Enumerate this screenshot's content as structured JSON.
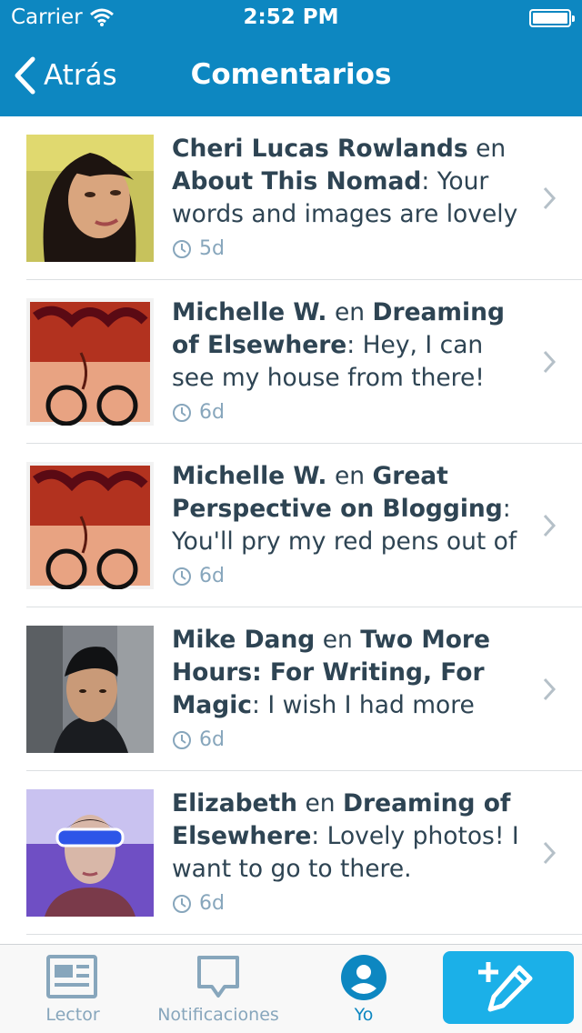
{
  "status_bar": {
    "carrier": "Carrier",
    "time": "2:52 PM"
  },
  "nav": {
    "back_label": "Atrás",
    "title": "Comentarios"
  },
  "comments": [
    {
      "author": "Cheri Lucas Rowlands",
      "connector": "en",
      "post": "About This Nomad",
      "excerpt": "Your words and images are lovely",
      "time": "5d"
    },
    {
      "author": "Michelle W.",
      "connector": "en",
      "post": "Dreaming of Elsewhere",
      "excerpt": "Hey, I can see my house from there!",
      "time": "6d"
    },
    {
      "author": "Michelle W.",
      "connector": "en",
      "post": "Great Perspective on Blogging",
      "excerpt": "You'll pry my red pens out of",
      "time": "6d"
    },
    {
      "author": "Mike Dang",
      "connector": "en",
      "post": "Two More Hours: For Writing, For Magic",
      "excerpt": "I wish I had more",
      "time": "6d"
    },
    {
      "author": "Elizabeth",
      "connector": "en",
      "post": "Dreaming of Elsewhere",
      "excerpt": "Lovely photos! I want to go to there.",
      "time": "6d"
    }
  ],
  "tabbar": {
    "reader_label": "Lector",
    "notifications_label": "Notificaciones",
    "me_label": "Yo",
    "active_tab": "Yo"
  },
  "colors": {
    "header": "#0d87c1",
    "accent": "#1bb0e8",
    "text": "#2e4453",
    "muted": "#87a6bc"
  },
  "icons": [
    "wifi-icon",
    "battery-icon",
    "back-chevron-icon",
    "clock-icon",
    "chevron-right-icon",
    "reader-icon",
    "notifications-icon",
    "me-icon",
    "write-post-icon"
  ]
}
